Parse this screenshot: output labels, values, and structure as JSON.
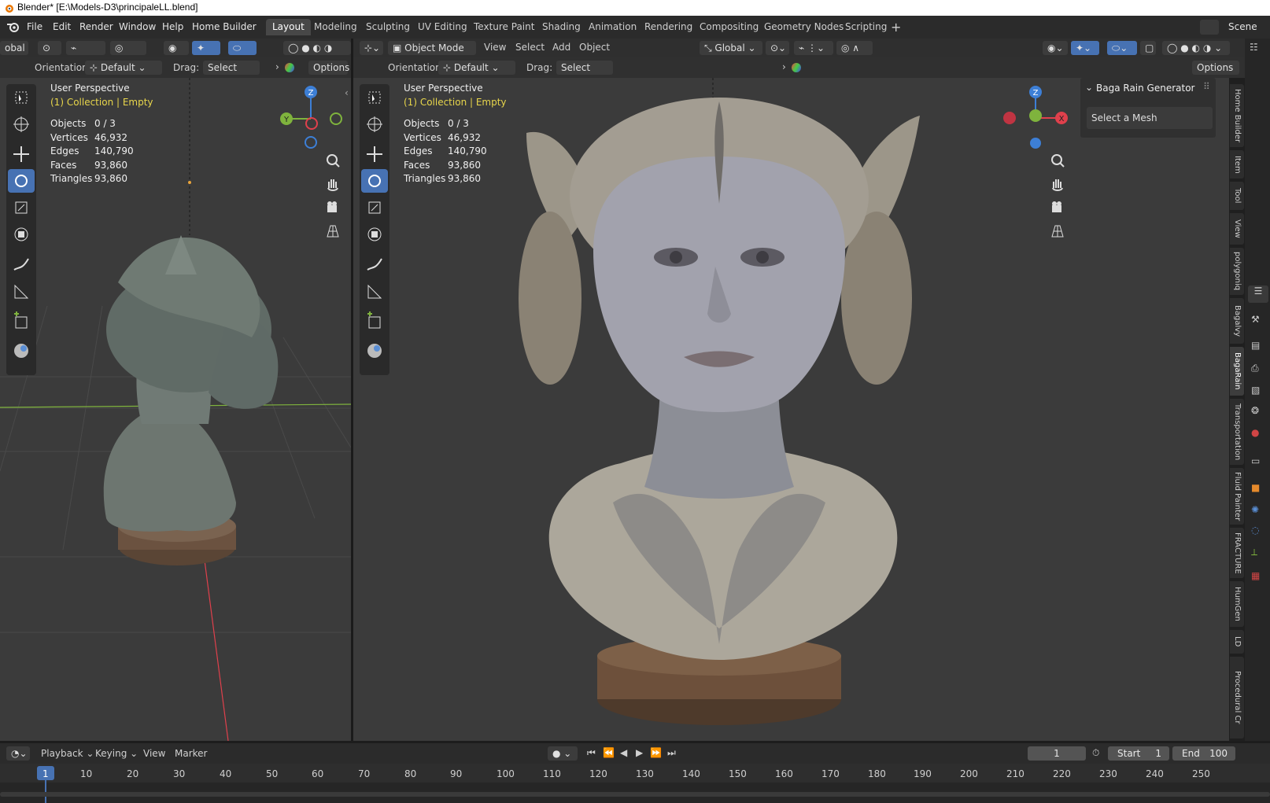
{
  "window": {
    "title": "Blender* [E:\\Models-D3\\principaleLL.blend]"
  },
  "menu": {
    "file": "File",
    "edit": "Edit",
    "render": "Render",
    "window": "Window",
    "help": "Help",
    "home_builder": "Home Builder"
  },
  "workspaces": [
    "Layout",
    "Modeling",
    "Sculpting",
    "UV Editing",
    "Texture Paint",
    "Shading",
    "Animation",
    "Rendering",
    "Compositing",
    "Geometry Nodes",
    "Scripting"
  ],
  "scene_label": "Scene",
  "left_view": {
    "header": {
      "transform_trunc": "obal"
    },
    "tool_header": {
      "orientation_label": "Orientation:",
      "orientation_value": "Default",
      "drag_label": "Drag:",
      "drag_value": "Select Box",
      "options": "Options"
    },
    "overlay": {
      "perspective": "User Perspective",
      "collection": "(1) Collection | Empty"
    },
    "stats": [
      {
        "k": "Objects",
        "v": "0 / 3"
      },
      {
        "k": "Vertices",
        "v": "46,932"
      },
      {
        "k": "Edges",
        "v": "140,790"
      },
      {
        "k": "Faces",
        "v": "93,860"
      },
      {
        "k": "Triangles",
        "v": "93,860"
      }
    ],
    "gizmo": {
      "z": "Z",
      "y": "Y"
    }
  },
  "right_view": {
    "header": {
      "mode": "Object Mode",
      "view": "View",
      "select": "Select",
      "add": "Add",
      "object": "Object",
      "transform": "Global"
    },
    "tool_header": {
      "orientation_label": "Orientation:",
      "orientation_value": "Default",
      "drag_label": "Drag:",
      "drag_value": "Select Box",
      "options": "Options"
    },
    "overlay": {
      "perspective": "User Perspective",
      "collection": "(1) Collection | Empty"
    },
    "stats": [
      {
        "k": "Objects",
        "v": "0 / 3"
      },
      {
        "k": "Vertices",
        "v": "46,932"
      },
      {
        "k": "Edges",
        "v": "140,790"
      },
      {
        "k": "Faces",
        "v": "93,860"
      },
      {
        "k": "Triangles",
        "v": "93,860"
      }
    ],
    "gizmo": {
      "z": "Z",
      "x": "X"
    },
    "npanel": {
      "title": "Baga Rain Generator",
      "field": "Select a Mesh"
    },
    "sidetabs": [
      "Home Builder",
      "Item",
      "Tool",
      "View",
      "polygoniq",
      "Bagalvy",
      "BagaRain",
      "Transportation",
      "Fluid Painter",
      "FRACTURE",
      "HumGen",
      "LD",
      "Procedural Cr"
    ]
  },
  "timeline": {
    "menu": {
      "playback": "Playback",
      "keying": "Keying",
      "view": "View",
      "marker": "Marker"
    },
    "current_frame": "1",
    "start_label": "Start",
    "start": "1",
    "end_label": "End",
    "end": "100",
    "ticks": [
      "1",
      "10",
      "20",
      "30",
      "40",
      "50",
      "60",
      "70",
      "80",
      "90",
      "100",
      "110",
      "120",
      "130",
      "140",
      "150",
      "160",
      "170",
      "180",
      "190",
      "200",
      "210",
      "220",
      "230",
      "240",
      "250"
    ]
  },
  "colors": {
    "accent": "#4772b3",
    "active_text": "#e8d64b",
    "axis_x": "#e0404c",
    "axis_y": "#7fb33d",
    "axis_z": "#3d7fd6"
  }
}
